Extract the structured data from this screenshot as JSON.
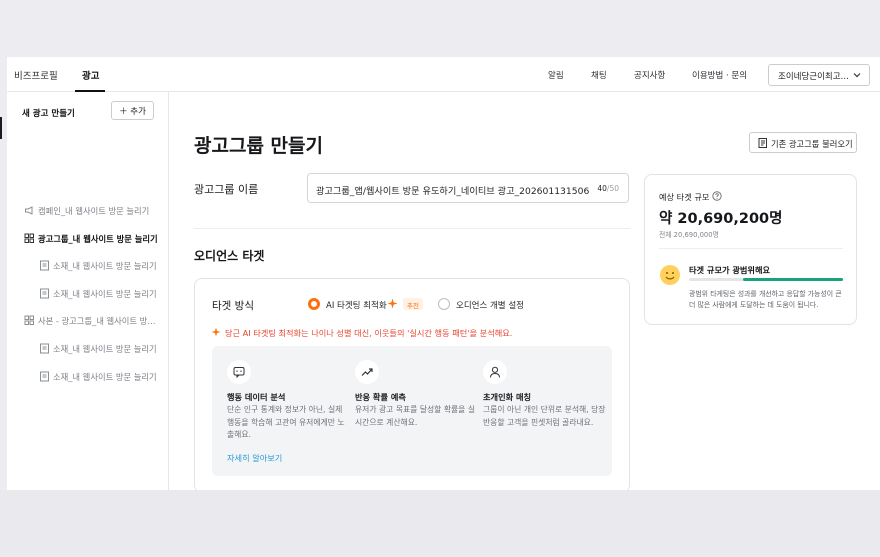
{
  "topnav": {
    "tabs": [
      {
        "label": "비즈프로필"
      },
      {
        "label": "광고"
      }
    ],
    "links": [
      {
        "label": "알림"
      },
      {
        "label": "채팅"
      },
      {
        "label": "공지사항"
      },
      {
        "label": "이용방법 · 문의"
      }
    ],
    "account": "조이네당근이최고…"
  },
  "sidebar": {
    "title": "새 광고 만들기",
    "add_label": "추가",
    "items": [
      {
        "label": "캠페인_내 웹사이트 방문 늘리기",
        "icon": "megaphone-icon"
      },
      {
        "label": "광고그룹_내 웹사이트 방문 늘리기",
        "icon": "group-icon"
      },
      {
        "label": "소재_내 웹사이트 방문 늘리기",
        "icon": "document-icon"
      },
      {
        "label": "소재_내 웹사이트 방문 늘리기",
        "icon": "document-icon"
      },
      {
        "label": "사본 - 광고그룹_내 웹사이트 방…",
        "icon": "group-icon"
      },
      {
        "label": "소재_내 웹사이트 방문 늘리기",
        "icon": "document-icon"
      },
      {
        "label": "소재_내 웹사이트 방문 늘리기",
        "icon": "document-icon"
      }
    ]
  },
  "main": {
    "title": "광고그룹 만들기",
    "load_button": "기존 광고그룹 불러오기",
    "name_label": "광고그룹 이름",
    "name_value": "광고그룹_앱/웹사이트 방문 유도하기_네이티브 광고_202601131506",
    "name_count": "40",
    "name_max": "/50",
    "audience_title": "오디언스 타겟",
    "targeting": {
      "label": "타겟 방식",
      "option_ai": "AI 타겟팅 최적화",
      "badge": "추천",
      "option_manual": "오디언스 개별 설정",
      "ai_note": "당근 AI 타겟팅 최적화는 나이나 성별 대신, 이웃들의 '실시간 행동 패턴'을 분석해요.",
      "features": [
        {
          "icon": "chat-icon",
          "title": "행동 데이터 분석",
          "desc": "단순 인구 통계와 정보가 아닌, 실제 행동을 학습해 고관여 유저에게만 노출해요."
        },
        {
          "icon": "trend-up-icon",
          "title": "반응 확률 예측",
          "desc": "유저가 광고 목표를 달성할 확률을 실시간으로 계산해요."
        },
        {
          "icon": "person-icon",
          "title": "초개인화 매칭",
          "desc": "그룹이 아닌 개인 단위로 분석해, 당장 반응할 고객을 핀셋처럼 골라내요."
        }
      ],
      "more_link": "자세히 알아보기"
    }
  },
  "estimate": {
    "label": "예상 타겟 규모",
    "value": "약 20,690,200명",
    "total": "전체 20,690,000명",
    "range_title": "타겟 규모가 광범위해요",
    "range_fill": 0.65,
    "range_desc": "광범위 타게팅은 성과를 개선하고 응답할 가능성이 큰 더 많은 사람에게 도달하는 데 도움이 됩니다.",
    "colors": {
      "accent": "#ff6f0f",
      "range": "#1aa37a",
      "link": "#2a9bd8",
      "note": "#e8452f"
    }
  }
}
